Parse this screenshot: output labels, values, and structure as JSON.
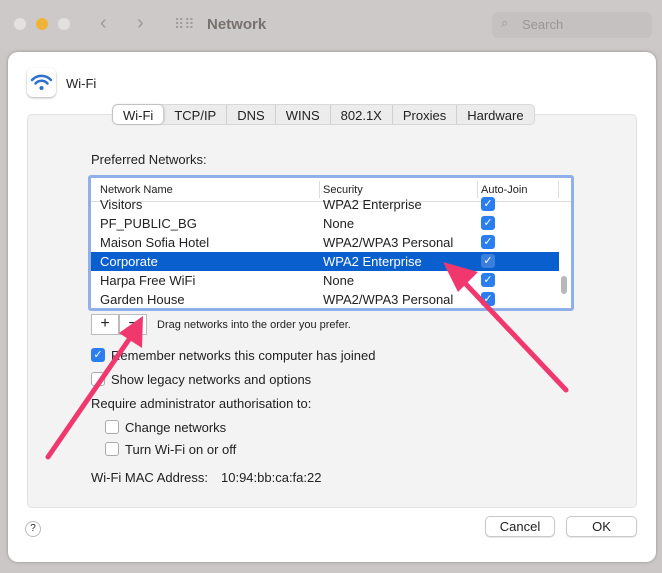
{
  "window": {
    "title": "Network",
    "search_placeholder": "Search"
  },
  "header": {
    "service": "Wi-Fi"
  },
  "tabs": [
    {
      "label": "Wi-Fi",
      "active": true
    },
    {
      "label": "TCP/IP"
    },
    {
      "label": "DNS"
    },
    {
      "label": "WINS"
    },
    {
      "label": "802.1X"
    },
    {
      "label": "Proxies"
    },
    {
      "label": "Hardware"
    }
  ],
  "preferred": {
    "label": "Preferred Networks:",
    "columns": [
      "Network Name",
      "Security",
      "Auto-Join"
    ],
    "rows": [
      {
        "name": "Visitors",
        "security": "WPA2 Enterprise",
        "auto_join": true
      },
      {
        "name": "PF_PUBLIC_BG",
        "security": "None",
        "auto_join": true
      },
      {
        "name": "Maison Sofia Hotel",
        "security": "WPA2/WPA3 Personal",
        "auto_join": true
      },
      {
        "name": "Corporate",
        "security": "WPA2 Enterprise",
        "auto_join": true,
        "selected": true
      },
      {
        "name": "Harpa Free WiFi",
        "security": "None",
        "auto_join": true
      },
      {
        "name": "Garden House",
        "security": "WPA2/WPA3 Personal",
        "auto_join": true
      }
    ]
  },
  "add_label": "+",
  "remove_label": "−",
  "drag_hint": "Drag networks into the order you prefer.",
  "options": {
    "remember": {
      "label": "Remember networks this computer has joined",
      "checked": true
    },
    "legacy": {
      "label": "Show legacy networks and options",
      "checked": false
    },
    "require_label": "Require administrator authorisation to:",
    "change": {
      "label": "Change networks",
      "checked": false
    },
    "toggle": {
      "label": "Turn Wi-Fi on or off",
      "checked": false
    }
  },
  "mac": {
    "label": "Wi-Fi MAC Address:",
    "value": "10:94:bb:ca:fa:22"
  },
  "footer": {
    "help": "?",
    "cancel": "Cancel",
    "ok": "OK"
  },
  "colors": {
    "accent": "#0a5fcf",
    "annotation_arrow": "#f0386e"
  }
}
